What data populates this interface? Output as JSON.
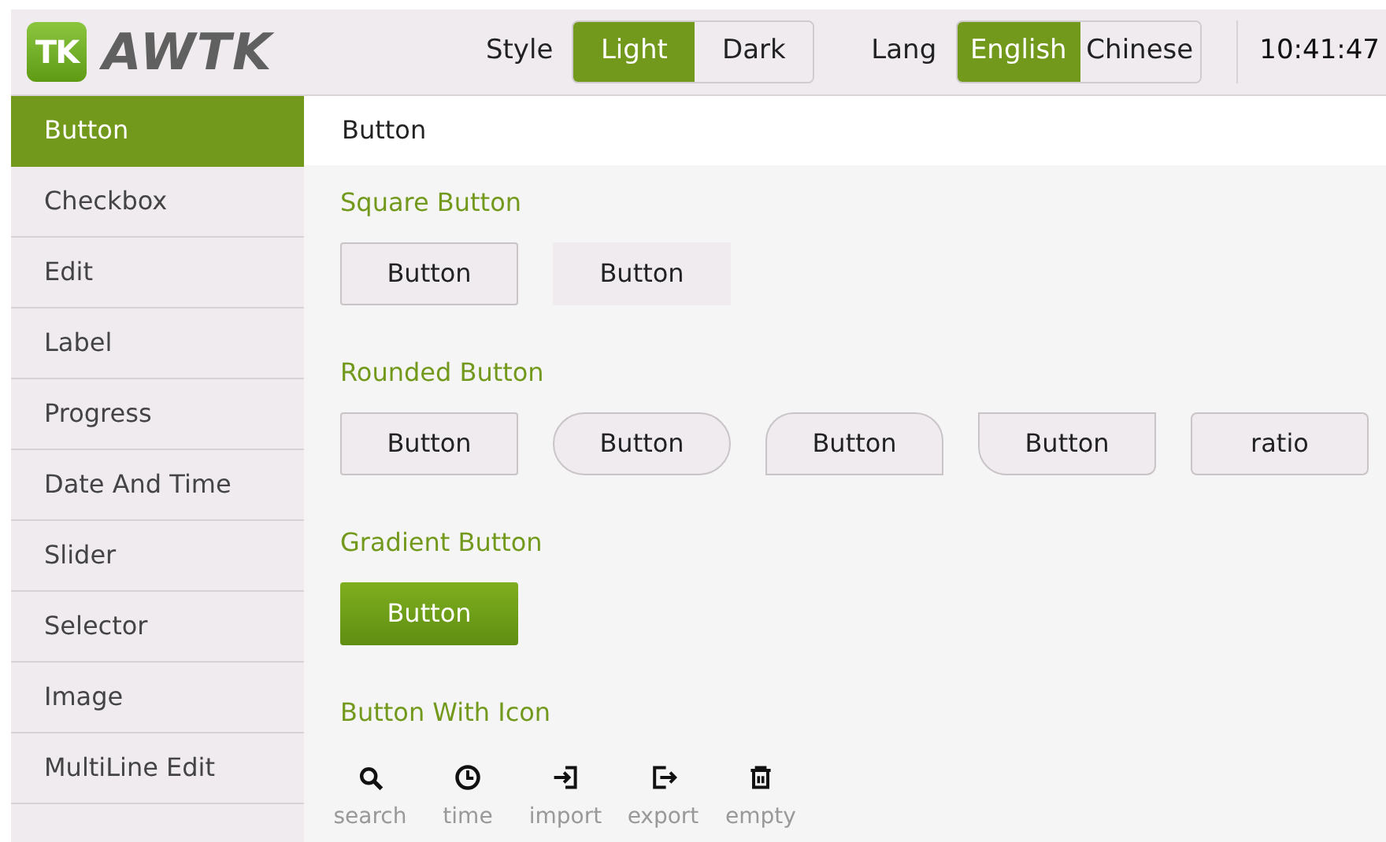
{
  "header": {
    "logo_badge": "TK",
    "logo_text": "AWTK",
    "style_label": "Style",
    "style_options": [
      {
        "label": "Light",
        "selected": true
      },
      {
        "label": "Dark",
        "selected": false
      }
    ],
    "lang_label": "Lang",
    "lang_options": [
      {
        "label": "English",
        "selected": true
      },
      {
        "label": "Chinese",
        "selected": false
      }
    ],
    "clock": "10:41:47"
  },
  "sidebar": {
    "items": [
      {
        "label": "Button",
        "selected": true
      },
      {
        "label": "Checkbox",
        "selected": false
      },
      {
        "label": "Edit",
        "selected": false
      },
      {
        "label": "Label",
        "selected": false
      },
      {
        "label": "Progress",
        "selected": false
      },
      {
        "label": "Date And Time",
        "selected": false
      },
      {
        "label": "Slider",
        "selected": false
      },
      {
        "label": "Selector",
        "selected": false
      },
      {
        "label": "Image",
        "selected": false
      },
      {
        "label": "MultiLine Edit",
        "selected": false
      }
    ]
  },
  "content": {
    "title": "Button",
    "sections": [
      {
        "heading": "Square Button",
        "kind": "buttons",
        "buttons": [
          {
            "label": "Button",
            "kind": "square"
          },
          {
            "label": "Button",
            "kind": "flat"
          }
        ]
      },
      {
        "heading": "Rounded Button",
        "kind": "buttons",
        "buttons": [
          {
            "label": "Button",
            "kind": "square"
          },
          {
            "label": "Button",
            "kind": "pill"
          },
          {
            "label": "Button",
            "kind": "top-rounded"
          },
          {
            "label": "Button",
            "kind": "bottom-rounded"
          },
          {
            "label": "ratio",
            "kind": "slight"
          }
        ]
      },
      {
        "heading": "Gradient Button",
        "kind": "buttons",
        "buttons": [
          {
            "label": "Button",
            "kind": "gradient"
          }
        ]
      },
      {
        "heading": "Button With Icon",
        "kind": "icons",
        "buttons": [
          {
            "label": "search",
            "kind": "search"
          },
          {
            "label": "time",
            "kind": "clock"
          },
          {
            "label": "import",
            "kind": "import"
          },
          {
            "label": "export",
            "kind": "export"
          },
          {
            "label": "empty",
            "kind": "trash"
          }
        ]
      }
    ]
  }
}
